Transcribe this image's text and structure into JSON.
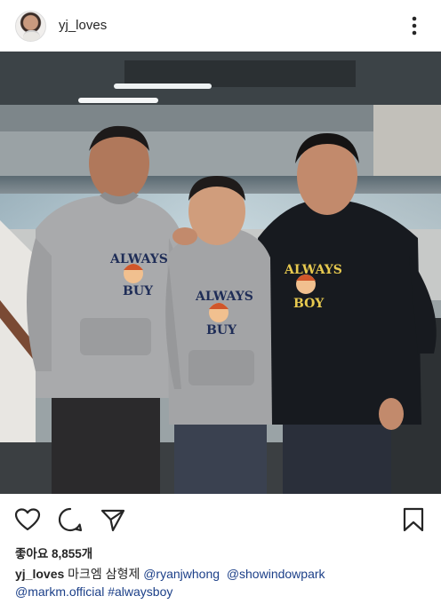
{
  "post": {
    "username": "yj_loves",
    "likes_text": "좋아요 8,855개",
    "caption": {
      "username": "yj_loves",
      "text": "마크엠 삼형제",
      "mentions": [
        "@ryanjwhong",
        "@showindowpark",
        "@markm.official"
      ],
      "hashtag": "#alwaysboy"
    },
    "photo_print": {
      "left_line1": "ALWAYS",
      "left_line2": "BUY",
      "center_line1": "ALWAYS",
      "center_line2": "BUY",
      "right_line1": "ALWAYS",
      "right_line2": "BOY"
    }
  },
  "icons": {
    "more": "more-vertical-icon",
    "like": "heart-icon",
    "comment": "comment-icon",
    "share": "send-icon",
    "save": "bookmark-icon"
  },
  "colors": {
    "text": "#262626",
    "link": "#1b3f88",
    "hoodie_grey": "#a9aaac",
    "hoodie_black": "#171a1f"
  }
}
